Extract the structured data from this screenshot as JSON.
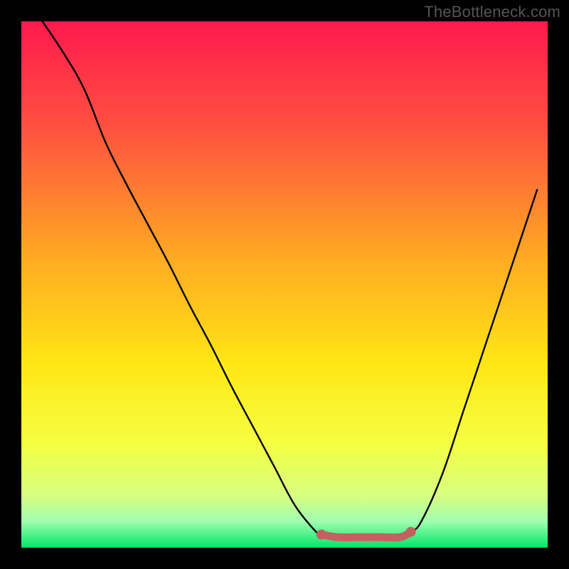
{
  "watermark": "TheBottleneck.com",
  "chart_data": {
    "type": "line",
    "title": "",
    "xlabel": "",
    "ylabel": "",
    "xlim": [
      0,
      100
    ],
    "ylim": [
      0,
      100
    ],
    "background_gradient": {
      "stops": [
        {
          "offset": 0.0,
          "color": "#ff1a4d"
        },
        {
          "offset": 0.2,
          "color": "#ff5040"
        },
        {
          "offset": 0.45,
          "color": "#ffaa22"
        },
        {
          "offset": 0.65,
          "color": "#ffe615"
        },
        {
          "offset": 0.8,
          "color": "#f5ff40"
        },
        {
          "offset": 0.9,
          "color": "#d8ff80"
        },
        {
          "offset": 0.95,
          "color": "#a0ffb0"
        },
        {
          "offset": 1.0,
          "color": "#00e566"
        }
      ]
    },
    "series": [
      {
        "name": "curve",
        "x": [
          4,
          8,
          12,
          16,
          20,
          24,
          28,
          32,
          36,
          40,
          44,
          48,
          52,
          56,
          57,
          60,
          64,
          68,
          72,
          74,
          76,
          80,
          84,
          88,
          92,
          96,
          98
        ],
        "values": [
          100,
          94,
          87,
          77,
          69,
          61.5,
          54,
          46,
          38.5,
          30.5,
          23,
          15.5,
          8,
          3,
          2.5,
          2,
          2,
          2,
          2,
          3,
          5,
          14,
          26,
          38,
          50,
          62,
          68
        ]
      }
    ],
    "highlight": {
      "type": "segment",
      "color": "#c56060",
      "x": [
        57,
        60,
        64,
        68,
        72,
        74
      ],
      "values": [
        2.5,
        2,
        2,
        2,
        2,
        3
      ],
      "dot": {
        "x": 57,
        "y": 2.5,
        "r": 1.1
      },
      "end_dot": {
        "x": 74,
        "y": 3,
        "r": 1.1
      }
    }
  }
}
